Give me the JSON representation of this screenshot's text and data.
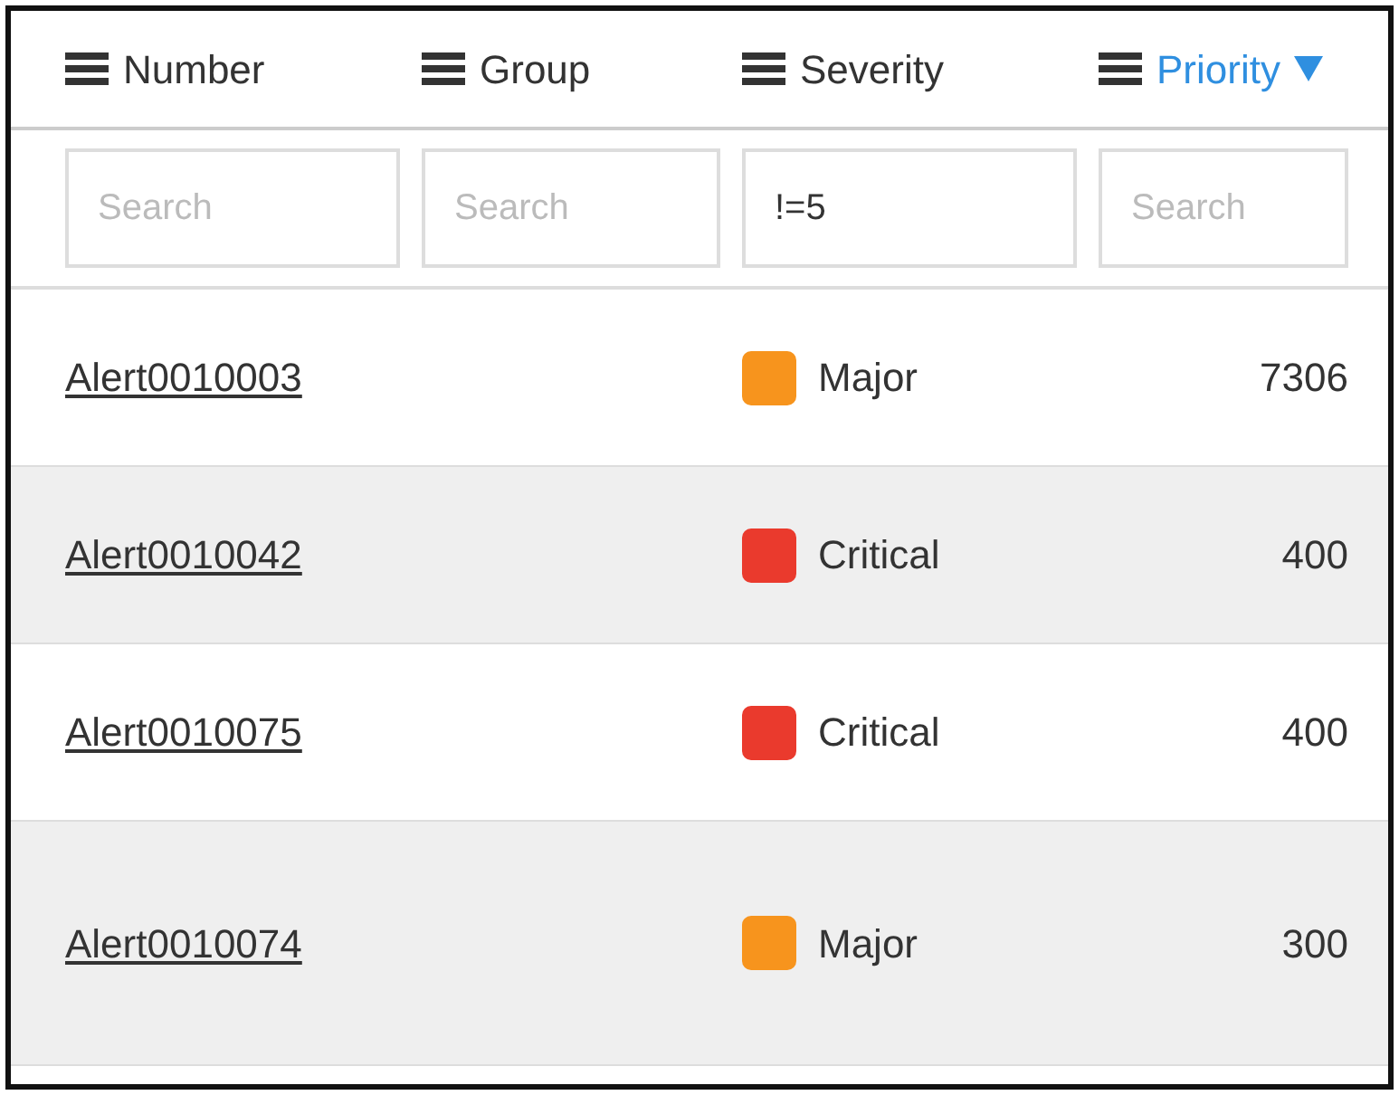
{
  "columns": [
    {
      "label": "Number",
      "sorted": false
    },
    {
      "label": "Group",
      "sorted": false
    },
    {
      "label": "Severity",
      "sorted": false
    },
    {
      "label": "Priority",
      "sorted": true
    }
  ],
  "filters": [
    {
      "placeholder": "Search"
    },
    {
      "placeholder": "Search"
    },
    {
      "value": "!=5"
    },
    {
      "placeholder": "Search"
    }
  ],
  "rows": [
    {
      "number": "Alert0010003",
      "severity": "Major",
      "color": "#f7941d",
      "priority": "7306"
    },
    {
      "number": "Alert0010042",
      "severity": "Critical",
      "color": "#ea3a2d",
      "priority": "400"
    },
    {
      "number": "Alert0010075",
      "severity": "Critical",
      "color": "#ea3a2d",
      "priority": "400"
    },
    {
      "number": "Alert0010074",
      "severity": "Major",
      "color": "#f7941d",
      "priority": "300"
    }
  ]
}
